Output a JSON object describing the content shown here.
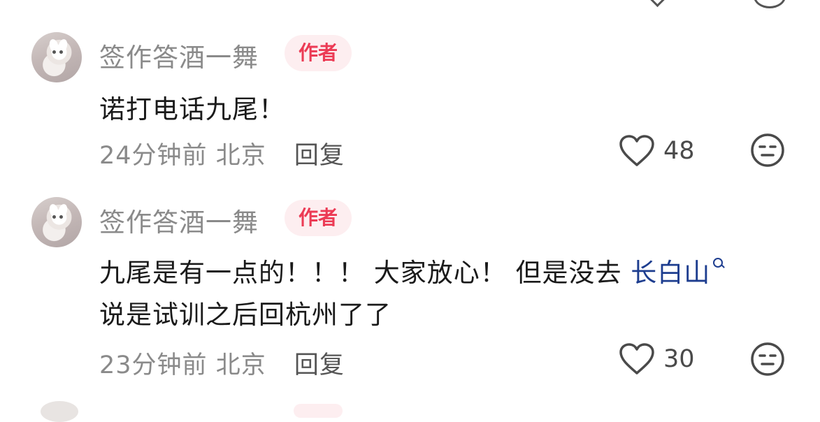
{
  "comments": [
    {
      "username": "签作答酒一舞",
      "badge": "作者",
      "lines": [
        "诺打电话九尾！"
      ],
      "time": "24分钟前",
      "location": "北京",
      "reply": "回复",
      "likes": "48"
    },
    {
      "username": "签作答酒一舞",
      "badge": "作者",
      "line1": "九尾是有一点的！！！ 大家放心！ 但是没去 ",
      "hashtag": "长白山",
      "line2": "说是试训之后回杭州了了",
      "time": "23分钟前",
      "location": "北京",
      "reply": "回复",
      "likes": "30"
    }
  ],
  "icons": {
    "like": "heart-outline-icon",
    "dislike": "neutral-face-icon",
    "hashtag": "search-icon"
  },
  "colors": {
    "badge_text": "#ec3b55",
    "badge_bg": "#fdeef0",
    "hashtag": "#1d3d8f",
    "meta": "#8a8a8a"
  }
}
